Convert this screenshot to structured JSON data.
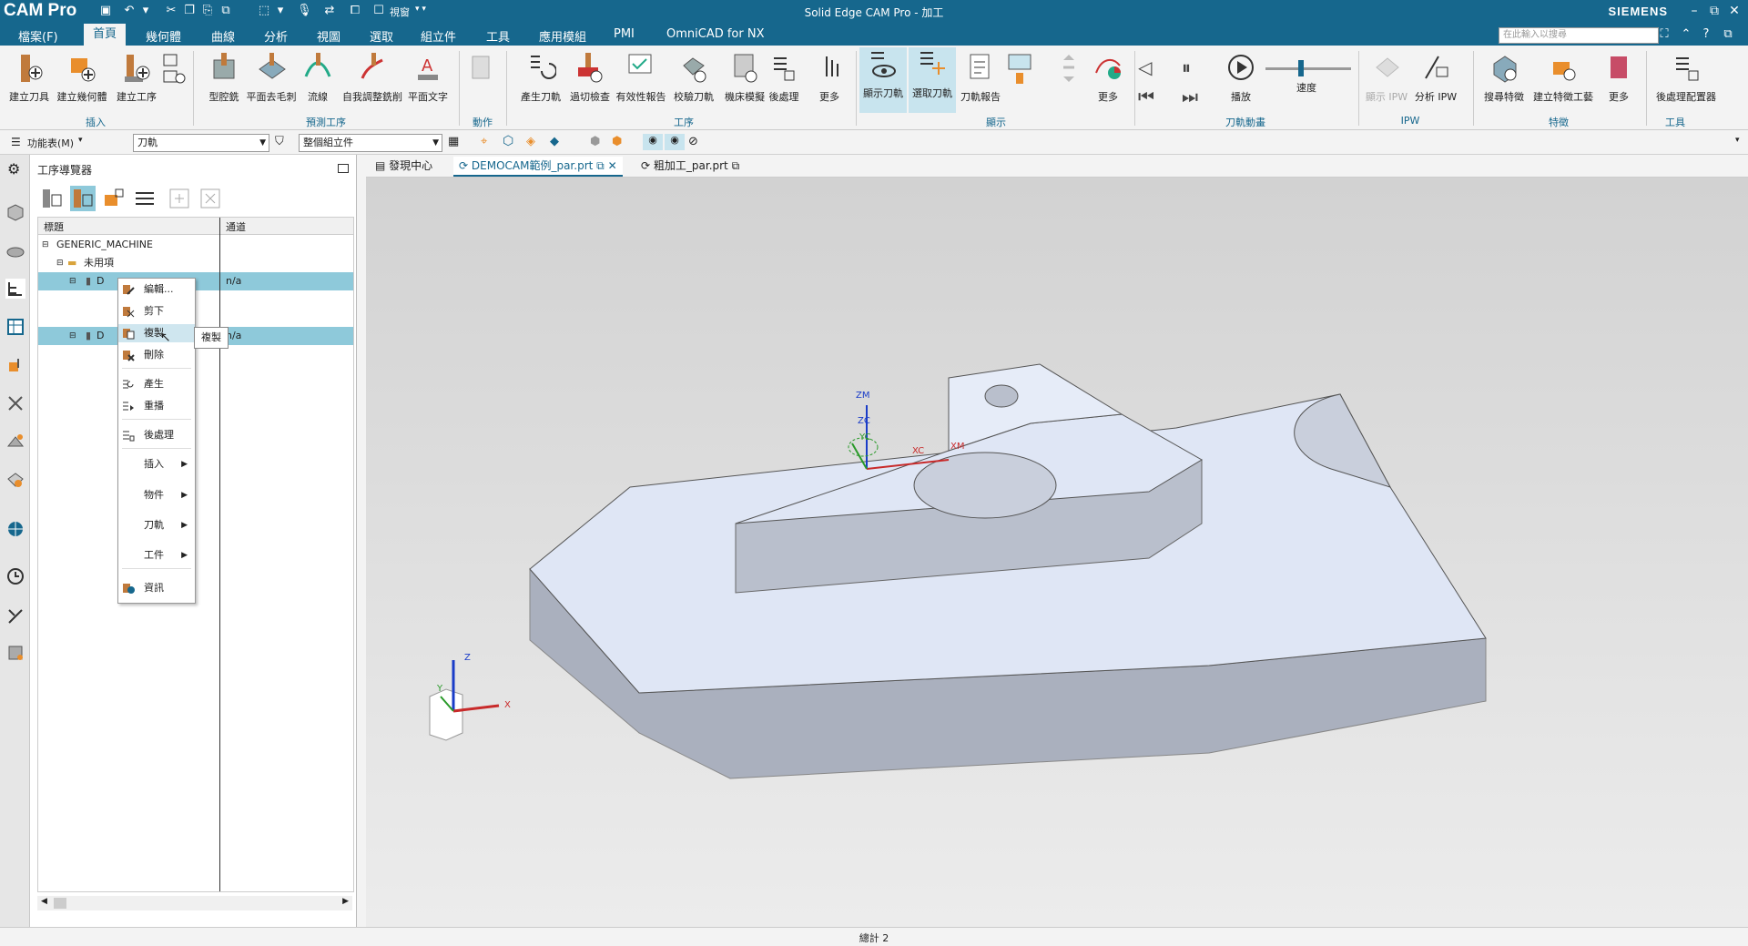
{
  "app": {
    "name": "CAM Pro",
    "title": "Solid Edge CAM Pro - 加工",
    "brand": "SIEMENS",
    "window_combo": "視窗"
  },
  "menu": [
    "檔案(F)",
    "首頁",
    "幾何體",
    "曲線",
    "分析",
    "視圖",
    "選取",
    "組立件",
    "工具",
    "應用模組",
    "PMI",
    "OmniCAD for NX"
  ],
  "search_placeholder": "在此輸入以搜尋",
  "ribbon": {
    "buttons": [
      "建立刀具",
      "建立幾何體",
      "建立工序",
      "",
      "型腔銑",
      "平面去毛刺",
      "流線",
      "自我調整銑削",
      "平面文字",
      "",
      "產生刀軌",
      "過切檢查",
      "有效性報告",
      "校驗刀軌",
      "機床模擬",
      "後處理",
      "更多",
      "顯示刀軌",
      "選取刀軌",
      "刀軌報告",
      "",
      "",
      "",
      "更多",
      "",
      "",
      "",
      "播放",
      "速度",
      "顯示 IPW",
      "分析 IPW",
      "搜尋特徵",
      "建立特徵工藝",
      "更多",
      "後處理配置器"
    ],
    "groups": [
      "插入",
      "預測工序",
      "動作",
      "工序",
      "顯示",
      "刀軌動畫",
      "IPW",
      "特徵",
      "工具"
    ]
  },
  "toolbar2": {
    "menu_label": "功能表(M)",
    "filter_value": "刀軌",
    "assembly_value": "整個組立件"
  },
  "navigator": {
    "title": "工序導覽器",
    "columns": [
      "標題",
      "通道"
    ],
    "rows": [
      {
        "name": "GENERIC_MACHINE",
        "channel": ""
      },
      {
        "name": "未用項",
        "channel": ""
      },
      {
        "name": "D",
        "channel": "n/a"
      },
      {
        "name": "D",
        "channel": "n/a"
      }
    ]
  },
  "context_menu": {
    "items": [
      "編輯...",
      "剪下",
      "複製",
      "刪除",
      "產生",
      "重播",
      "後處理",
      "插入",
      "物件",
      "刀軌",
      "工件",
      "資訊"
    ],
    "tooltip": "複製"
  },
  "tabs": [
    "發現中心",
    "DEMOCAM範例_par.prt",
    "粗加工_par.prt"
  ],
  "viewport": {
    "axes": [
      "ZM",
      "ZC",
      "YC",
      "XC",
      "XM",
      "X",
      "Y",
      "Z"
    ]
  },
  "status": "總計 2",
  "colors": {
    "brand": "#16678d",
    "selection": "#8ec9da",
    "part_face": "#dfe6f5",
    "part_side": "#b9bfcc"
  }
}
